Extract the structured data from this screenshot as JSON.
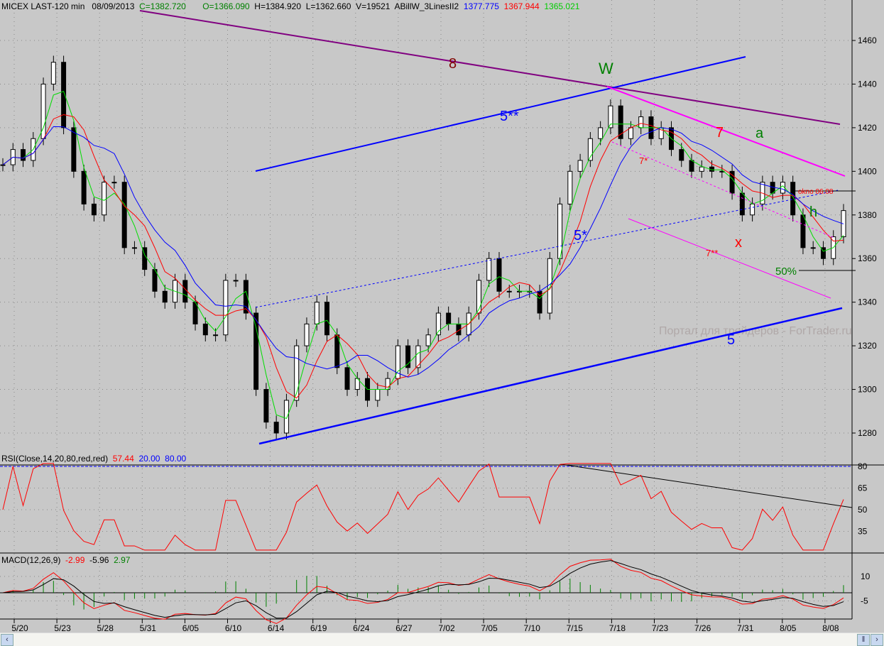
{
  "header": {
    "symbol": "MICEX LAST-120 min",
    "date": "08/09/2013",
    "close": "C=1382.720",
    "open": "O=1366.090",
    "high": "H=1384.920",
    "low": "L=1362.660",
    "volume": "V=19521",
    "indicator": "ABillW_3LinesII2",
    "ma_blue": "1377.775",
    "ma_red": "1367.944",
    "ma_green": "1365.021"
  },
  "rsi_header": {
    "label": "RSI(Close,14,20,80,red,red)",
    "value": "57.44",
    "low": "20.00",
    "high": "80.00"
  },
  "macd_header": {
    "label": "MACD(12,26,9)",
    "macd": "-2.99",
    "signal": "-5.96",
    "hist": "2.97"
  },
  "annotations": {
    "w8": "8",
    "W": "W",
    "w5ss": "5**",
    "w7": "7",
    "a": "a",
    "w7s": "7*",
    "w5s": "5*",
    "x": "x",
    "h": "h",
    "w7ss": "7**",
    "fifty": "50%",
    "w5": "5",
    "okno": "okno 06.08"
  },
  "watermark": "Портал для трейдеров - ForTrader.ru",
  "colors": {
    "ma_blue": "#0000ff",
    "ma_red": "#ff0000",
    "ma_green": "#00dd00",
    "trend8": "#800080",
    "trend5": "#0000ff",
    "trend7": "#ff00ff",
    "background": "#c8c8c8"
  },
  "chart_data": {
    "type": "candlestick",
    "price_axis": {
      "ticks": [
        1280,
        1300,
        1320,
        1340,
        1360,
        1380,
        1400,
        1420,
        1440,
        1460
      ],
      "ylim": [
        1262,
        1474
      ]
    },
    "date_ticks": [
      "5/20",
      "5/23",
      "5/28",
      "5/31",
      "6/05",
      "6/10",
      "6/14",
      "6/19",
      "6/24",
      "6/27",
      "7/02",
      "7/05",
      "7/10",
      "7/15",
      "7/18",
      "7/23",
      "7/26",
      "7/31",
      "8/05",
      "8/08"
    ],
    "close": [
      1403,
      1410,
      1405,
      1415,
      1440,
      1450,
      1420,
      1400,
      1385,
      1380,
      1395,
      1395,
      1365,
      1365,
      1355,
      1345,
      1340,
      1350,
      1340,
      1330,
      1325,
      1325,
      1350,
      1350,
      1335,
      1300,
      1285,
      1280,
      1295,
      1320,
      1330,
      1340,
      1325,
      1310,
      1300,
      1305,
      1295,
      1300,
      1305,
      1320,
      1310,
      1320,
      1325,
      1335,
      1330,
      1325,
      1335,
      1350,
      1360,
      1345,
      1345,
      1345,
      1345,
      1335,
      1360,
      1385,
      1400,
      1405,
      1415,
      1420,
      1430,
      1415,
      1420,
      1425,
      1415,
      1420,
      1410,
      1405,
      1400,
      1402,
      1400,
      1400,
      1390,
      1380,
      1385,
      1395,
      1390,
      1395,
      1380,
      1365,
      1365,
      1360,
      1370,
      1382
    ],
    "rsi_axis": {
      "ticks": [
        35,
        50,
        65,
        80
      ],
      "ylim": [
        20,
        80
      ]
    },
    "macd_axis": {
      "ticks": [
        -5,
        10
      ]
    }
  }
}
